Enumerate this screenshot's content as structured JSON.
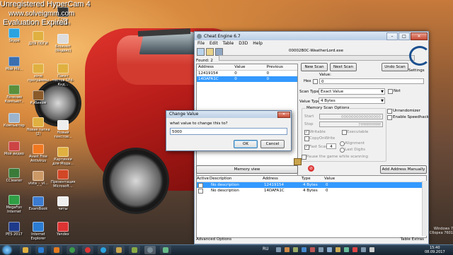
{
  "watermark": {
    "line1": "Unregistered HyperCam 4",
    "line2": "www.solveigmm.com",
    "line3": "Evaluation Expired"
  },
  "desktop_icons": [
    {
      "label": "Skype",
      "color": "#2aa3e0"
    },
    {
      "label": "Мой Мо...",
      "color": "#3b6fb0"
    },
    {
      "label": "Лечение Компьют..",
      "color": "#5b8f3c"
    },
    {
      "label": "Компьютер",
      "color": "#9bb4cc"
    },
    {
      "label": "Мой видео",
      "color": "#c44"
    },
    {
      "label": "CCleaner",
      "color": "#3a7b3a"
    },
    {
      "label": "MegaFon Internet",
      "color": "#2f9e44"
    },
    {
      "label": "PES 2017",
      "color": "#1e3a8a"
    },
    {
      "label": "ДЛЯ ПОГИ",
      "color": "#e0b040"
    },
    {
      "label": "хоче программы",
      "color": "#e0b040"
    },
    {
      "label": "Кубиком",
      "color": "#8a5a2a"
    },
    {
      "label": "Новая папка (2)",
      "color": "#e0b040"
    },
    {
      "label": "Avast Free Antivirus",
      "color": "#f07820"
    },
    {
      "label": "vista_-_vi...",
      "color": "#c96"
    },
    {
      "label": "ExamBook",
      "color": "#3b7bd1"
    },
    {
      "label": "Internet Explorer",
      "color": "#2b7cd3"
    },
    {
      "label": "Стим (Steam)",
      "color": "#333"
    },
    {
      "label": "Блокнот (Яндекс)",
      "color": "#ddd"
    },
    {
      "label": "Пакет тестов 5Pd-Кнд...",
      "color": "#e0b040"
    },
    {
      "label": "Новый текстов...",
      "color": "#eee"
    },
    {
      "label": "Картинки для Мода...",
      "color": "#e0b040"
    },
    {
      "label": "Презентация Microsoft...",
      "color": "#d24726"
    },
    {
      "label": "читы",
      "color": "#eee"
    },
    {
      "label": "Yandex",
      "color": "#d33"
    }
  ],
  "cheat_engine": {
    "title": "Cheat Engine 6.7",
    "menu": [
      "File",
      "Edit",
      "Table",
      "D3D",
      "Help"
    ],
    "process": "00002B0C-WeatherLord.exe",
    "found": "Found: 2",
    "results_columns": [
      "Address",
      "Value",
      "Previous"
    ],
    "results": [
      {
        "address": "12419154",
        "value": "0",
        "previous": "0",
        "selected": false
      },
      {
        "address": "14DAFA1C",
        "value": "0",
        "previous": "0",
        "selected": true
      }
    ],
    "new_scan": "New Scan",
    "next_scan": "Next Scan",
    "undo_scan": "Undo Scan",
    "settings": "Settings",
    "value_label": "Value:",
    "hex_label": "Hex",
    "value_input": "0",
    "scan_type_label": "Scan Type",
    "scan_type_value": "Exact Value",
    "not_label": "Not",
    "value_type_label": "Value Type",
    "value_type_value": "4 Bytes",
    "memory_scan_options": "Memory Scan Options",
    "start_label": "Start",
    "start_value": "0000000000000000",
    "stop_label": "Stop",
    "stop_value": "7fffffffffffffff",
    "writable": "Writable",
    "executable": "Executable",
    "copyonwrite": "CopyOnWrite",
    "fast_scan": "Fast Scan",
    "fast_scan_value": "4",
    "alignment": "Alignment",
    "last_digits": "Last Digits",
    "pause_game": "Pause the game while scanning",
    "unrandomizer": "Unrandomizer",
    "enable_speedhack": "Enable Speedhack",
    "memory_view": "Memory view",
    "add_address_manually": "Add Address Manually",
    "address_columns": [
      "Active",
      "Description",
      "Address",
      "Type",
      "Value"
    ],
    "address_rows": [
      {
        "description": "No description",
        "address": "12419154",
        "type": "4 Bytes",
        "value": "0",
        "selected": true
      },
      {
        "description": "No description",
        "address": "14DAFA1C",
        "type": "4 Bytes",
        "value": "0",
        "selected": false
      }
    ],
    "advanced_options": "Advanced Options",
    "table_extras": "Table Extras"
  },
  "dialog": {
    "title": "Change Value",
    "prompt": "what value to change this to?",
    "input_value": "5000",
    "ok": "OK",
    "cancel": "Cancel"
  },
  "taskbar": {
    "language": "RU",
    "time": "15:40",
    "date": "08.09.2017",
    "windows_watermark": "Windows 7 Сборка 7601"
  }
}
